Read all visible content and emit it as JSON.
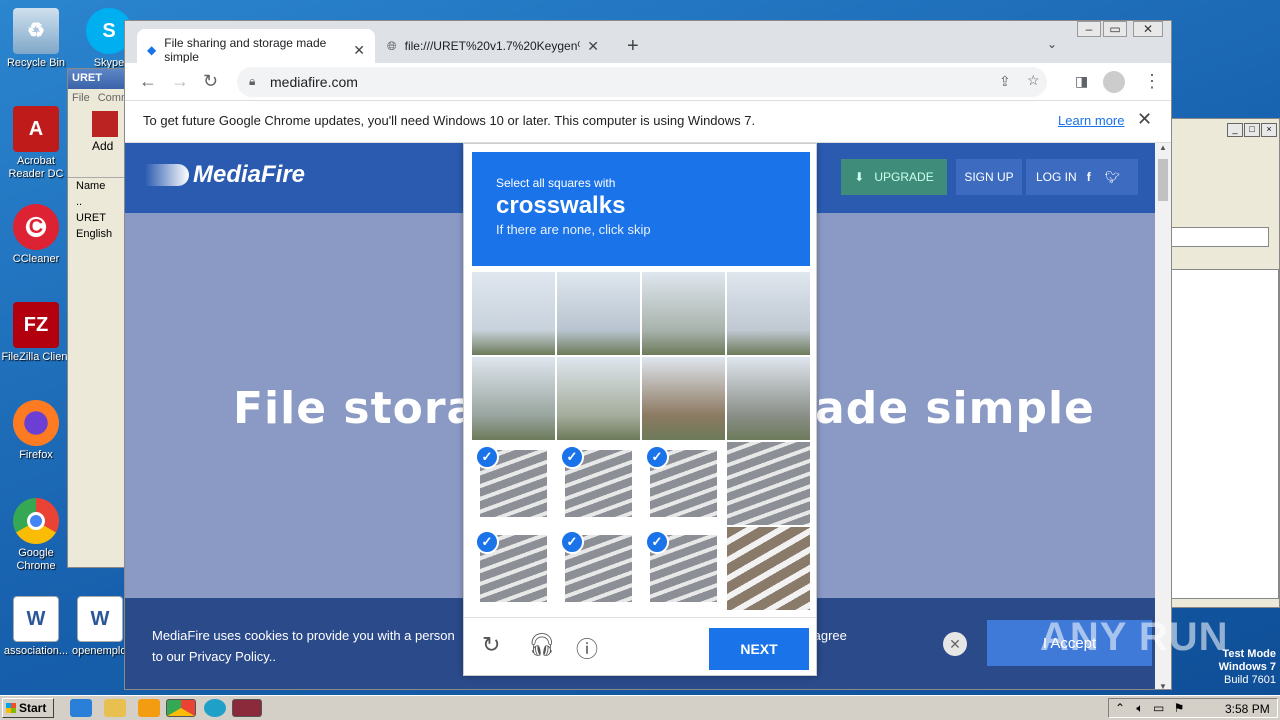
{
  "desktop": {
    "icons": [
      {
        "label": "Recycle Bin",
        "icon": "recycle-bin-icon"
      },
      {
        "label": "Acrobat Reader DC",
        "icon": "acrobat-icon"
      },
      {
        "label": "CCleaner",
        "icon": "ccleaner-icon"
      },
      {
        "label": "FileZilla Client",
        "icon": "filezilla-icon"
      },
      {
        "label": "Firefox",
        "icon": "firefox-icon"
      },
      {
        "label": "Google Chrome",
        "icon": "chrome-icon"
      },
      {
        "label": "association...",
        "icon": "word-doc-icon"
      },
      {
        "label": "openemplo...",
        "icon": "word-doc-icon"
      },
      {
        "label": "Skype",
        "icon": "skype-icon"
      }
    ]
  },
  "explorer": {
    "title": "URET",
    "menu": [
      "File",
      "Comm"
    ],
    "add_label": "Add",
    "column": "Name",
    "rows": [
      "..",
      "URET",
      "English"
    ]
  },
  "browser": {
    "tabs": [
      {
        "title": "File sharing and storage made simple",
        "active": true
      },
      {
        "title": "file:///URET%20v1.7%20Keygen%20",
        "active": false
      }
    ],
    "url": "mediafire.com",
    "infobar_text": "To get future Google Chrome updates, you'll need Windows 10 or later. This computer is using Windows 7.",
    "infobar_link": "Learn more"
  },
  "mediafire": {
    "logo": "MediaFire",
    "upgrade": "UPGRADE",
    "signup": "SIGN UP",
    "login": "LOG IN",
    "hero_left": "File storag",
    "hero_right": "ade simple",
    "cookie_line1_left": "MediaFire uses cookies to provide you with a person",
    "cookie_line1_right": "u agree",
    "cookie_line2": "to our Privacy Policy..",
    "accept": "I Accept"
  },
  "captcha": {
    "instruction": "Select all squares with",
    "target": "crosswalks",
    "hint": "If there are none, click skip",
    "selected": [
      8,
      9,
      10,
      12,
      13,
      14
    ],
    "next": "NEXT"
  },
  "taskbar": {
    "start": "Start",
    "time": "3:58 PM"
  },
  "watermark": {
    "brand": "ANY RUN",
    "line1": "Test Mode",
    "line2": "Windows 7",
    "line3": "Build 7601"
  },
  "colors": {
    "accent": "#1a73e8",
    "mf_blue": "#2b5bb0"
  }
}
